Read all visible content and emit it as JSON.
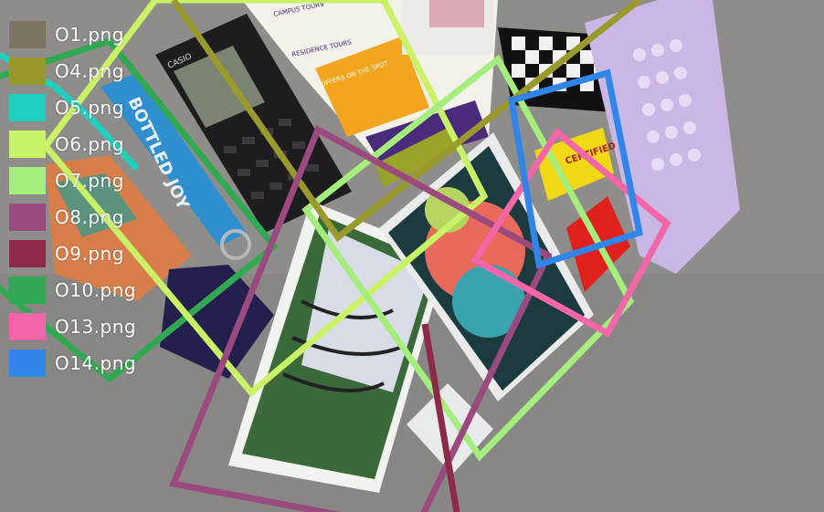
{
  "legend": {
    "items": [
      {
        "label": "O1.png",
        "color": "#7d7465"
      },
      {
        "label": "O4.png",
        "color": "#9a9a2c"
      },
      {
        "label": "O5.png",
        "color": "#1fd0c0"
      },
      {
        "label": "O6.png",
        "color": "#c9f266"
      },
      {
        "label": "O7.png",
        "color": "#a5ee7e"
      },
      {
        "label": "O8.png",
        "color": "#9a4a7e"
      },
      {
        "label": "O9.png",
        "color": "#8c2a48"
      },
      {
        "label": "O10.png",
        "color": "#33a852"
      },
      {
        "label": "O13.png",
        "color": "#f566a8"
      },
      {
        "label": "O14.png",
        "color": "#2f86e8"
      }
    ]
  },
  "photo": {
    "background": "#8e8c88",
    "calculator_brand": "CASIO",
    "lanyard_text": "BOTTLED JOY",
    "sticker_text": "CERTIFIED",
    "flyer_heading": "CAMPUS TOURS",
    "flyer_subheading": "RESIDENCE TOURS",
    "flyer_banner": "OFFERS ON THE SPOT"
  }
}
